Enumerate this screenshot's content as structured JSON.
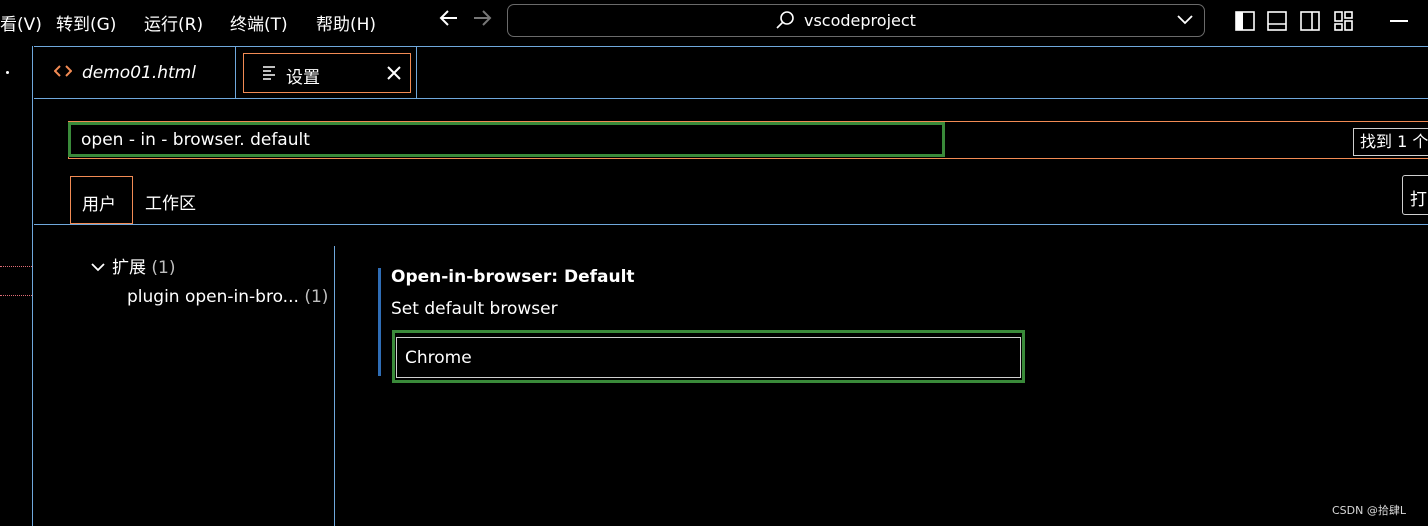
{
  "menu": {
    "items": [
      "看(V)",
      "转到(G)",
      "运行(R)",
      "终端(T)",
      "帮助(H)"
    ]
  },
  "command_center": {
    "text": "vscodeproject",
    "icon": "search-icon"
  },
  "tabs": [
    {
      "label": "demo01.html",
      "icon": "html-code-icon"
    },
    {
      "label": "设置",
      "icon": "settings-lines-icon"
    }
  ],
  "search": {
    "value": "open - in - browser. default",
    "found_label": "找到 1 个"
  },
  "scope_tabs": {
    "user": "用户",
    "workspace": "工作区"
  },
  "open_json_label": "打",
  "toc": {
    "extensions_label": "扩展",
    "extensions_count": "(1)",
    "plugin_label": "plugin open-in-bro...",
    "plugin_count": "(1)"
  },
  "setting": {
    "title": "Open-in-browser: Default",
    "description": "Set default browser",
    "value": "Chrome"
  },
  "watermark": "CSDN @拾肆L",
  "colors": {
    "accent_orange": "#f28b54",
    "border_blue": "#6fa8dc",
    "highlight_green": "#3a8a3a",
    "modified_bar": "#2f6db5"
  }
}
